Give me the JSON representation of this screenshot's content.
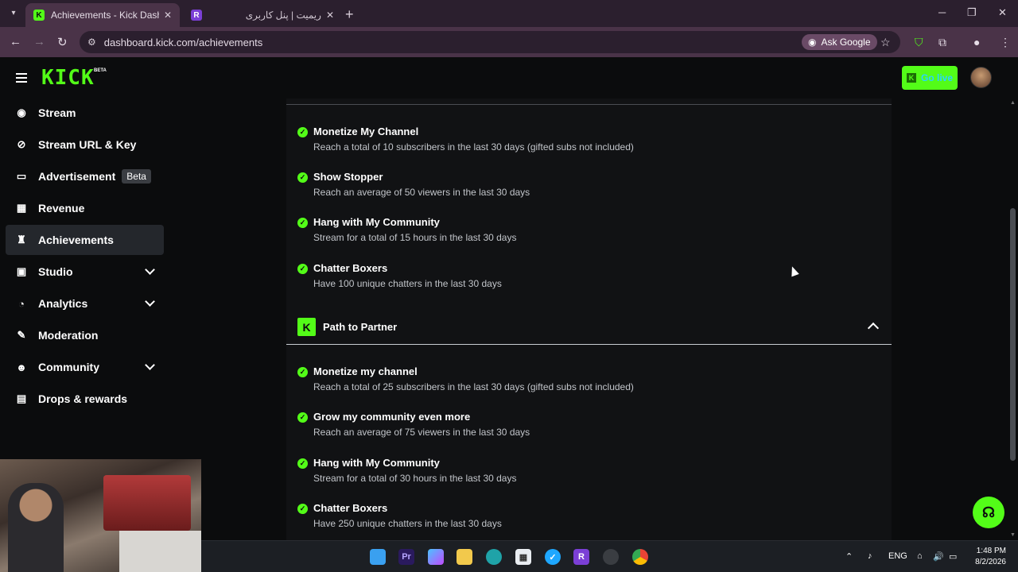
{
  "browser": {
    "tabs": [
      {
        "title": "Achievements - Kick Dashboard",
        "favicon": "K"
      },
      {
        "title": "ریمیت | پنل کاربری",
        "favicon": "R"
      }
    ],
    "url": "dashboard.kick.com/achievements",
    "ask_google": "Ask Google"
  },
  "header": {
    "logo": "KICK",
    "logo_badge": "BETA",
    "go_live": "Go live"
  },
  "sidebar": {
    "items": [
      {
        "label": "Stream",
        "icon": "broadcast-icon"
      },
      {
        "label": "Stream URL & Key",
        "icon": "link-icon"
      },
      {
        "label": "Advertisement",
        "icon": "monitor-icon",
        "badge": "Beta"
      },
      {
        "label": "Revenue",
        "icon": "chart-icon"
      },
      {
        "label": "Achievements",
        "icon": "trophy-icon",
        "active": true
      },
      {
        "label": "Studio",
        "icon": "film-icon",
        "expandable": true
      },
      {
        "label": "Analytics",
        "icon": "analytics-icon",
        "expandable": true
      },
      {
        "label": "Moderation",
        "icon": "wrench-icon"
      },
      {
        "label": "Community",
        "icon": "users-icon",
        "expandable": true
      },
      {
        "label": "Drops & rewards",
        "icon": "gift-icon"
      }
    ]
  },
  "achievements_top": [
    {
      "name": "Monetize My Channel",
      "desc": "Reach a total of 10 subscribers in the last 30 days (gifted subs not included)"
    },
    {
      "name": "Show Stopper",
      "desc": "Reach an average of 50 viewers in the last 30 days"
    },
    {
      "name": "Hang with My Community",
      "desc": "Stream for a total of 15 hours in the last 30 days"
    },
    {
      "name": "Chatter Boxers",
      "desc": "Have 100 unique chatters in the last 30 days"
    }
  ],
  "section": {
    "title": "Path to Partner"
  },
  "achievements_partner": [
    {
      "name": "Monetize my channel",
      "desc": "Reach a total of 25 subscribers in the last 30 days (gifted subs not included)"
    },
    {
      "name": "Grow my community even more",
      "desc": "Reach an average of 75 viewers in the last 30 days"
    },
    {
      "name": "Hang with My Community",
      "desc": "Stream for a total of 30 hours in the last 30 days"
    },
    {
      "name": "Chatter Boxers",
      "desc": "Have 250 unique chatters in the last 30 days"
    }
  ],
  "taskbar": {
    "lang": "ENG",
    "time": "1:48 PM",
    "date": "8/2/2026"
  },
  "colors": {
    "accent": "#53fc18",
    "background": "#0b0c0d",
    "card": "#111214"
  }
}
